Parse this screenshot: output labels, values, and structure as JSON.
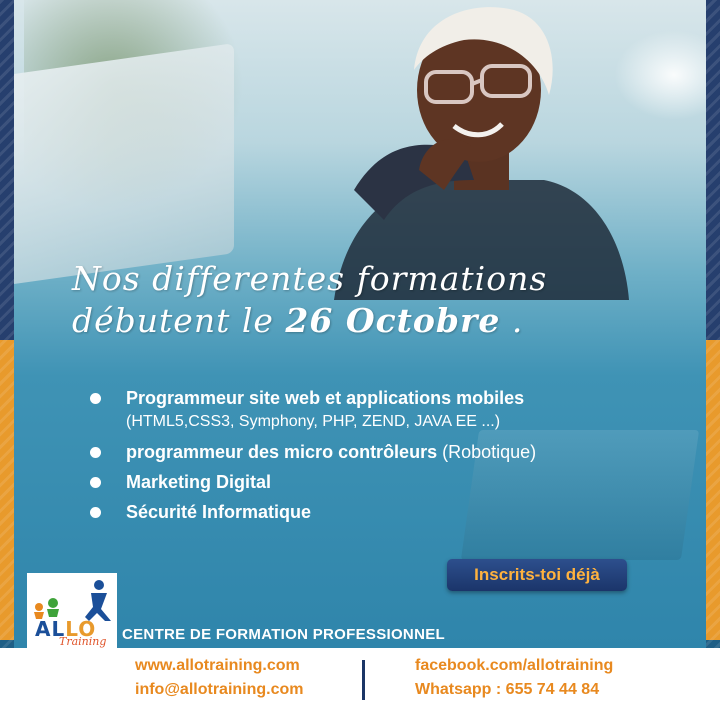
{
  "headline": {
    "line1": "Nos differentes formations",
    "line2_prefix": "débutent le ",
    "date": "26 Octobre",
    "line2_suffix": " ."
  },
  "courses": [
    {
      "title": "Programmeur site web et applications mobiles",
      "extra": "",
      "detail": "(HTML5,CSS3, Symphony, PHP, ZEND, JAVA EE ...)"
    },
    {
      "title": "programmeur des micro contrôleurs",
      "extra": " (Robotique)",
      "detail": ""
    },
    {
      "title": "Marketing Digital",
      "extra": "",
      "detail": ""
    },
    {
      "title": "Sécurité Informatique",
      "extra": "",
      "detail": ""
    }
  ],
  "cta": {
    "label": "Inscrits-toi déjà"
  },
  "logo": {
    "word_a": "AL",
    "word_b": "LO",
    "tagline": "Training"
  },
  "centre_label": "CENTRE DE FORMATION PROFESSIONNEL",
  "footer": {
    "website": "www.allotraining.com",
    "email": "info@allotraining.com",
    "facebook": "facebook.com/allotraining",
    "whatsapp": "Whatsapp : 655 74 44 84"
  },
  "colors": {
    "accent": "#e8891f",
    "navy": "#1b3566",
    "teal": "#2f85ab"
  },
  "icons": [
    "bullet-dot-icon",
    "divider-line"
  ]
}
